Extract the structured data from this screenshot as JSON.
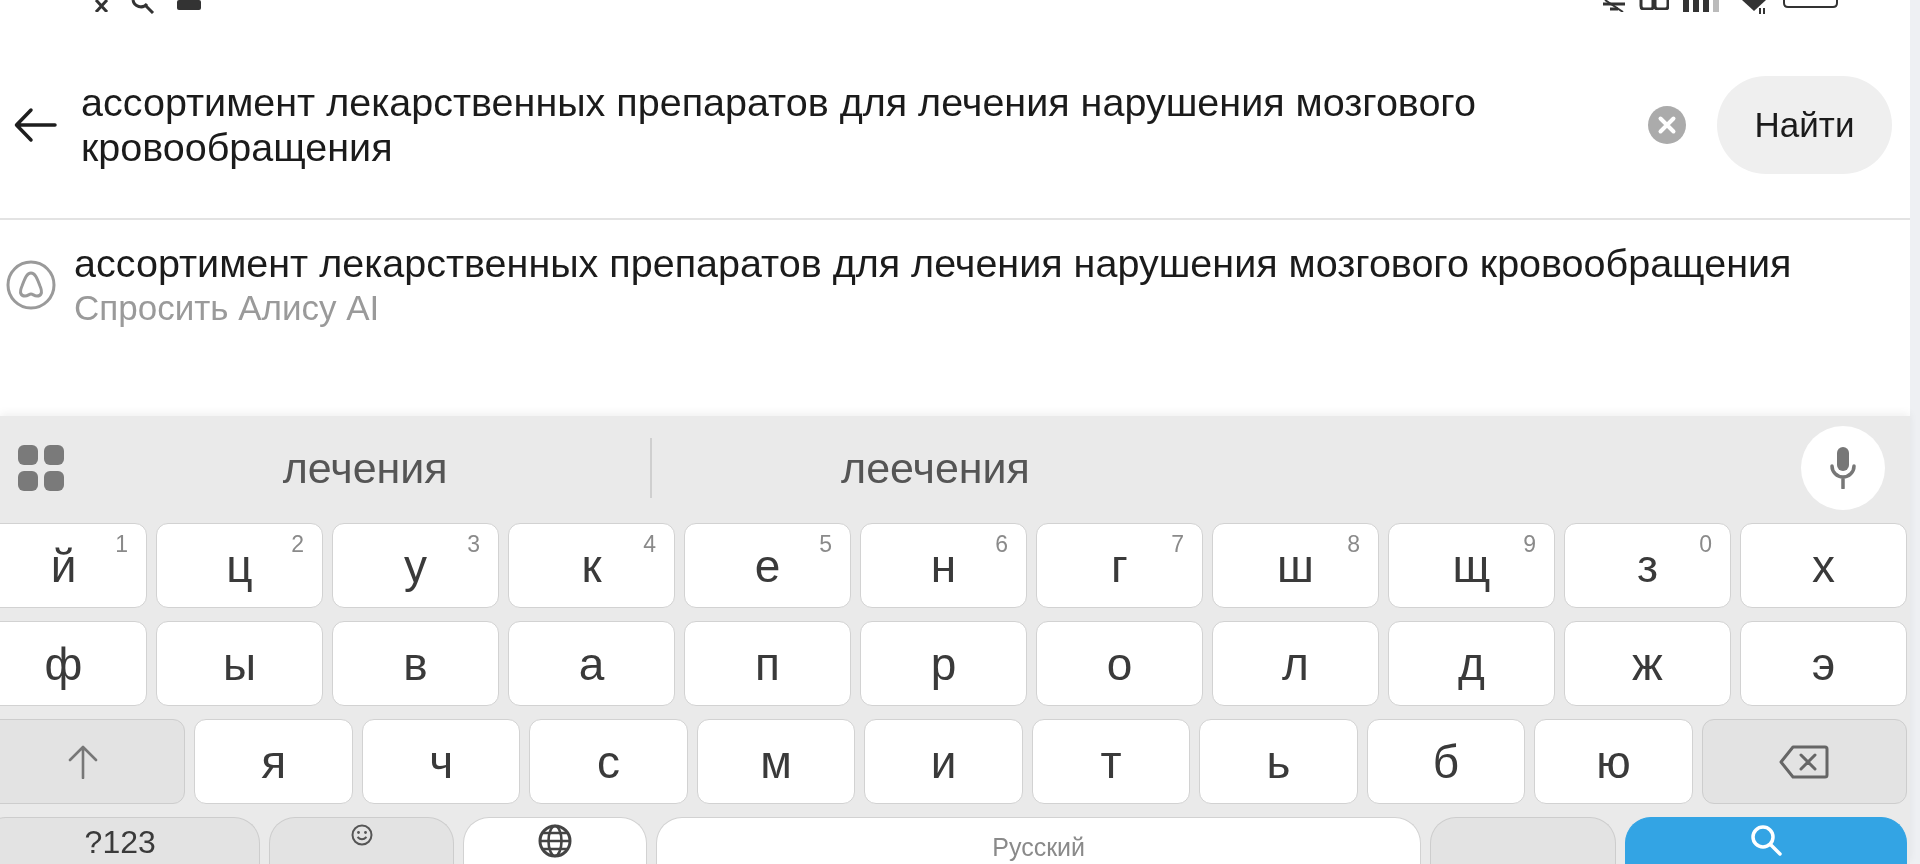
{
  "search": {
    "value": "ассортимент лекарственных препаратов для лечения нарушения мозгового кровообращения",
    "button": "Найти"
  },
  "suggestions": [
    {
      "text": "ассортимент лекарственных препаратов для лечения нарушения мозгового кровообращения",
      "subtitle": "Спросить Алису AI"
    }
  ],
  "keyboard": {
    "suggestions": [
      {
        "text": "лечения"
      },
      {
        "text": "леечения"
      }
    ],
    "rows": [
      [
        {
          "kind": "letter",
          "label": "й",
          "hint": "1"
        },
        {
          "kind": "letter",
          "label": "ц",
          "hint": "2"
        },
        {
          "kind": "letter",
          "label": "у",
          "hint": "3"
        },
        {
          "kind": "letter",
          "label": "к",
          "hint": "4"
        },
        {
          "kind": "letter",
          "label": "е",
          "hint": "5"
        },
        {
          "kind": "letter",
          "label": "н",
          "hint": "6"
        },
        {
          "kind": "letter",
          "label": "г",
          "hint": "7"
        },
        {
          "kind": "letter",
          "label": "ш",
          "hint": "8"
        },
        {
          "kind": "letter",
          "label": "щ",
          "hint": "9"
        },
        {
          "kind": "letter",
          "label": "з",
          "hint": "0"
        },
        {
          "kind": "letter",
          "label": "х"
        }
      ],
      [
        {
          "kind": "letter",
          "label": "ф"
        },
        {
          "kind": "letter",
          "label": "ы"
        },
        {
          "kind": "letter",
          "label": "в"
        },
        {
          "kind": "letter",
          "label": "а"
        },
        {
          "kind": "letter",
          "label": "п"
        },
        {
          "kind": "letter",
          "label": "р"
        },
        {
          "kind": "letter",
          "label": "о"
        },
        {
          "kind": "letter",
          "label": "л"
        },
        {
          "kind": "letter",
          "label": "д"
        },
        {
          "kind": "letter",
          "label": "ж"
        },
        {
          "kind": "letter",
          "label": "э"
        }
      ],
      [
        {
          "kind": "shift"
        },
        {
          "kind": "letter",
          "label": "я"
        },
        {
          "kind": "letter",
          "label": "ч"
        },
        {
          "kind": "letter",
          "label": "с"
        },
        {
          "kind": "letter",
          "label": "м"
        },
        {
          "kind": "letter",
          "label": "и"
        },
        {
          "kind": "letter",
          "label": "т"
        },
        {
          "kind": "letter",
          "label": "ь"
        },
        {
          "kind": "letter",
          "label": "б"
        },
        {
          "kind": "letter",
          "label": "ю"
        },
        {
          "kind": "backspace"
        }
      ],
      [
        {
          "kind": "symbols",
          "label": "?123"
        },
        {
          "kind": "emoji"
        },
        {
          "kind": "language"
        },
        {
          "kind": "space",
          "label": "Русский"
        },
        {
          "kind": "blank"
        },
        {
          "kind": "search"
        }
      ]
    ]
  }
}
